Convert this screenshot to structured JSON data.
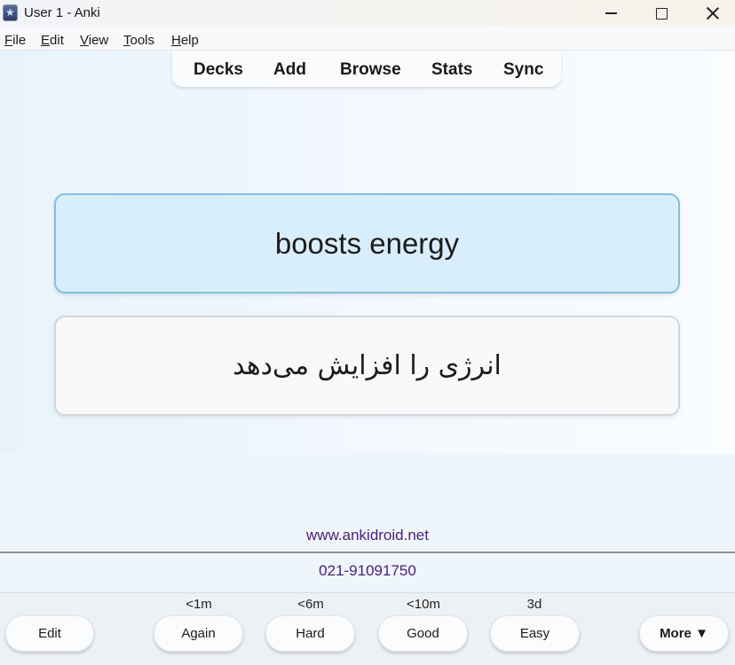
{
  "window": {
    "title": "User 1 - Anki"
  },
  "menu": [
    {
      "key": "F",
      "rest": "ile"
    },
    {
      "key": "E",
      "rest": "dit"
    },
    {
      "key": "V",
      "rest": "iew"
    },
    {
      "key": "T",
      "rest": "ools"
    },
    {
      "key": "H",
      "rest": "elp"
    }
  ],
  "toolbar": {
    "decks": "Decks",
    "add": "Add",
    "browse": "Browse",
    "stats": "Stats",
    "sync": "Sync"
  },
  "card": {
    "front": "boosts energy",
    "back": "انرژی را افزایش می‌دهد"
  },
  "footer": {
    "website": "www.ankidroid.net",
    "phone": "021-91091750"
  },
  "answer": {
    "edit": "Edit",
    "again": {
      "label": "Again",
      "interval": "<1m"
    },
    "hard": {
      "label": "Hard",
      "interval": "<6m"
    },
    "good": {
      "label": "Good",
      "interval": "<10m"
    },
    "easy": {
      "label": "Easy",
      "interval": "3d"
    },
    "more": "More ▼"
  }
}
